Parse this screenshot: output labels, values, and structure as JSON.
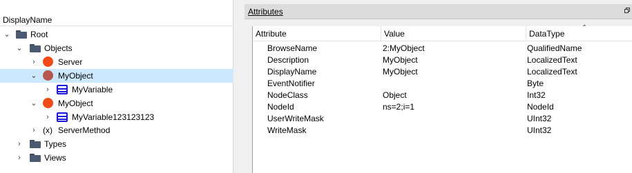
{
  "tree": {
    "header": "DisplayName",
    "nodes": [
      {
        "label": "Root",
        "expand": "expanded",
        "icon": "folder-icon"
      },
      {
        "label": "Objects",
        "expand": "expanded",
        "icon": "folder-icon"
      },
      {
        "label": "Server",
        "expand": "collapsed",
        "icon": "object-icon"
      },
      {
        "label": "MyObject",
        "expand": "expanded",
        "icon": "object-icon",
        "selected": true
      },
      {
        "label": "MyVariable",
        "expand": "collapsed",
        "icon": "variable-icon"
      },
      {
        "label": "MyObject",
        "expand": "expanded",
        "icon": "object-icon"
      },
      {
        "label": "MyVariable123123123",
        "expand": "collapsed",
        "icon": "variable-icon"
      },
      {
        "label": "ServerMethod",
        "expand": "collapsed",
        "icon": "method-icon",
        "icon_text": "(x)"
      },
      {
        "label": "Types",
        "expand": "collapsed",
        "icon": "folder-icon"
      },
      {
        "label": "Views",
        "expand": "collapsed",
        "icon": "folder-icon"
      }
    ]
  },
  "attributes": {
    "title": "Attributes",
    "columns": [
      "Attribute",
      "Value",
      "DataType"
    ],
    "rows": [
      [
        "BrowseName",
        "2:MyObject",
        "QualifiedName"
      ],
      [
        "Description",
        "MyObject",
        "LocalizedText"
      ],
      [
        "DisplayName",
        "MyObject",
        "LocalizedText"
      ],
      [
        "EventNotifier",
        "",
        "Byte"
      ],
      [
        "NodeClass",
        "Object",
        "Int32"
      ],
      [
        "NodeId",
        "ns=2;i=1",
        "NodeId"
      ],
      [
        "UserWriteMask",
        "",
        "UInt32"
      ],
      [
        "WriteMask",
        "",
        "UInt32"
      ]
    ]
  },
  "colors": {
    "selection": "#cce8ff",
    "object_active": "#f04a18",
    "object_selected": "#b5574c",
    "variable_blue": "#1a1ad6",
    "folder": "#4b5a70"
  }
}
